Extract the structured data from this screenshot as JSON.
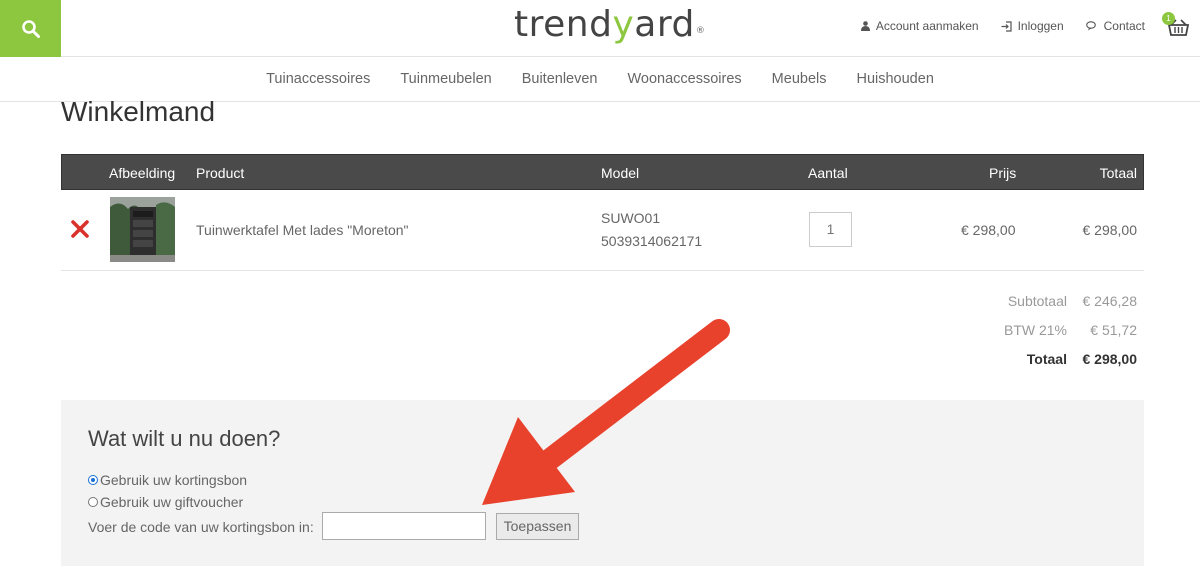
{
  "header": {
    "logo_pre": "trend",
    "logo_y": "y",
    "logo_post": "ard",
    "logo_reg": "®",
    "links": [
      {
        "label": "Account aanmaken",
        "icon": "user-icon"
      },
      {
        "label": "Inloggen",
        "icon": "login-icon"
      },
      {
        "label": "Contact",
        "icon": "chat-icon"
      }
    ],
    "cart_count": "1"
  },
  "nav": [
    "Tuinaccessoires",
    "Tuinmeubelen",
    "Buitenleven",
    "Woonaccessoires",
    "Meubels",
    "Huishouden"
  ],
  "page_title": "Winkelmand",
  "table": {
    "headers": {
      "image": "Afbeelding",
      "product": "Product",
      "model": "Model",
      "qty": "Aantal",
      "price": "Prijs",
      "total": "Totaal"
    },
    "row": {
      "product": "Tuinwerktafel Met lades \"Moreton\"",
      "model": "SUWO01",
      "ean": "5039314062171",
      "qty": "1",
      "price": "€ 298,00",
      "total": "€ 298,00"
    }
  },
  "totals": [
    {
      "label": "Subtotaal",
      "value": "€ 246,28"
    },
    {
      "label": "BTW 21%",
      "value": "€ 51,72"
    },
    {
      "label": "Totaal",
      "value": "€ 298,00"
    }
  ],
  "panel": {
    "title": "Wat wilt u nu doen?",
    "option1": "Gebruik uw kortingsbon",
    "option2": "Gebruik uw giftvoucher",
    "code_label": "Voer de code van uw kortingsbon in:",
    "code_value": "",
    "apply_label": "Toepassen"
  },
  "colors": {
    "brand": "#8dc63f",
    "header_bg": "#4a4a4a",
    "arrow": "#e8412c",
    "remove": "#d9312b"
  }
}
